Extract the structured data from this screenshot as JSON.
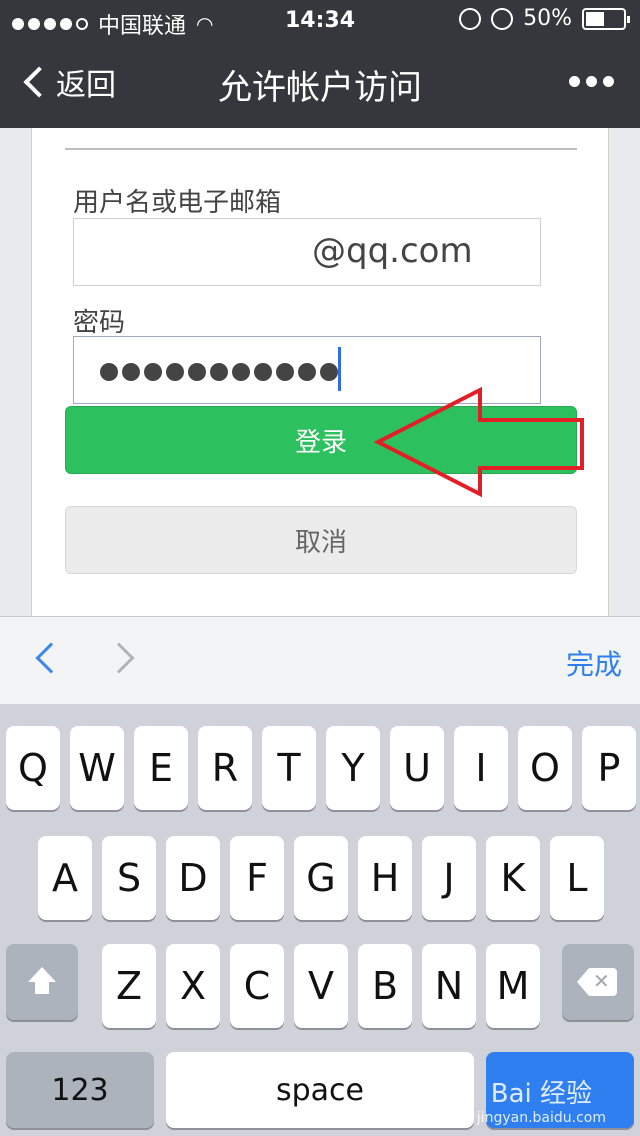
{
  "status_bar": {
    "carrier": "中国联通",
    "time": "14:34",
    "battery": "50%",
    "signal_bars": 4
  },
  "nav": {
    "back_label": "返回",
    "title": "允许帐户访问"
  },
  "form": {
    "username_label": "用户名或电子邮箱",
    "username_value": "@qq.com",
    "password_label": "密码",
    "password_mask_count": 11,
    "login_button": "登录",
    "cancel_button": "取消"
  },
  "keyboard_accessory": {
    "done_label": "完成"
  },
  "keyboard": {
    "row1": [
      "Q",
      "W",
      "E",
      "R",
      "T",
      "Y",
      "U",
      "I",
      "O",
      "P"
    ],
    "row2": [
      "A",
      "S",
      "D",
      "F",
      "G",
      "H",
      "J",
      "K",
      "L"
    ],
    "row3": [
      "Z",
      "X",
      "C",
      "V",
      "B",
      "N",
      "M"
    ],
    "num_label": "123",
    "space_label": "space"
  },
  "watermark": {
    "logo_text": "Bai 经验",
    "url": "jingyan.baidu.com"
  },
  "colors": {
    "nav_bg": "#36373c",
    "login_green": "#2dc05e",
    "accent_blue": "#2f7ff0",
    "annotation_red": "#e21f26"
  }
}
